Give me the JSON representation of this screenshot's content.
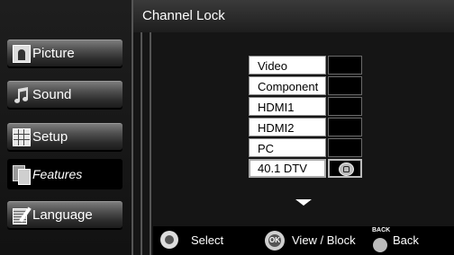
{
  "header": {
    "title": "Channel Lock"
  },
  "sidebar": {
    "items": [
      {
        "label": "Picture",
        "icon": "picture-icon",
        "selected": false
      },
      {
        "label": "Sound",
        "icon": "sound-icon",
        "selected": false
      },
      {
        "label": "Setup",
        "icon": "setup-icon",
        "selected": false
      },
      {
        "label": "Features",
        "icon": "features-icon",
        "selected": true
      },
      {
        "label": "Language",
        "icon": "language-icon",
        "selected": false
      }
    ]
  },
  "channel_list": {
    "rows": [
      {
        "label": "Video",
        "locked": false,
        "selected": false
      },
      {
        "label": "Component",
        "locked": false,
        "selected": false
      },
      {
        "label": "HDMI1",
        "locked": false,
        "selected": false
      },
      {
        "label": "HDMI2",
        "locked": false,
        "selected": false
      },
      {
        "label": "PC",
        "locked": false,
        "selected": false
      },
      {
        "label": "40.1 DTV",
        "locked": true,
        "selected": true
      }
    ]
  },
  "footer": {
    "select_label": "Select",
    "ok_button_text": "OK",
    "view_block_label": "View / Block",
    "back_caption": "BACK",
    "back_label": "Back"
  },
  "colors": {
    "background": "#0a0a0a",
    "row_background": "#ffffff",
    "lock_box": "#000000"
  }
}
